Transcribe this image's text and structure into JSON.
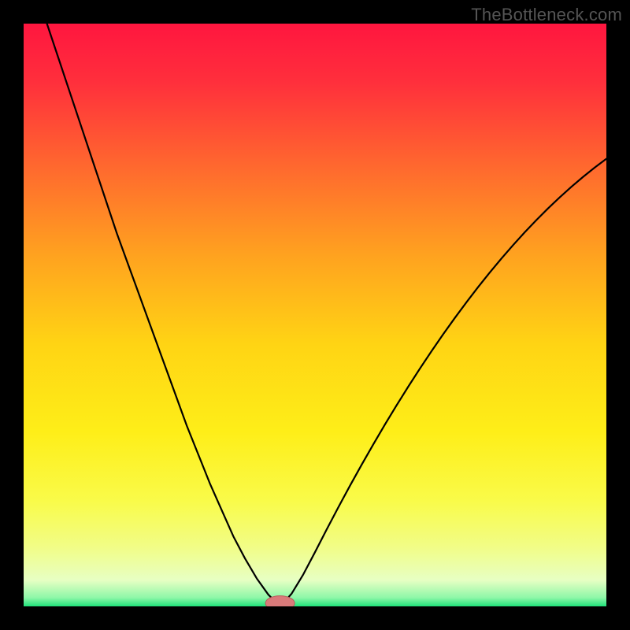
{
  "watermark": "TheBottleneck.com",
  "colors": {
    "frame": "#000000",
    "gradient_stops": [
      {
        "offset": 0.0,
        "color": "#ff163f"
      },
      {
        "offset": 0.1,
        "color": "#ff2f3c"
      },
      {
        "offset": 0.25,
        "color": "#ff6a2e"
      },
      {
        "offset": 0.4,
        "color": "#ffa31f"
      },
      {
        "offset": 0.55,
        "color": "#ffd414"
      },
      {
        "offset": 0.7,
        "color": "#feee18"
      },
      {
        "offset": 0.82,
        "color": "#f9fb4a"
      },
      {
        "offset": 0.9,
        "color": "#f1fd88"
      },
      {
        "offset": 0.955,
        "color": "#e7ffc3"
      },
      {
        "offset": 0.985,
        "color": "#8ff7a8"
      },
      {
        "offset": 1.0,
        "color": "#1ee27a"
      }
    ],
    "curve": "#000000",
    "marker_fill": "#d97a7a",
    "marker_stroke": "#b85a5a"
  },
  "chart_data": {
    "type": "line",
    "title": "",
    "xlabel": "",
    "ylabel": "",
    "xlim": [
      0,
      100
    ],
    "ylim": [
      0,
      100
    ],
    "grid": false,
    "legend": false,
    "optimum_x": 44,
    "marker": {
      "x": 44,
      "y": 0,
      "rx": 2.5,
      "ry": 1.0
    },
    "series": [
      {
        "name": "left-branch",
        "x": [
          4,
          6,
          8,
          10,
          12,
          14,
          16,
          18,
          20,
          22,
          24,
          26,
          28,
          30,
          32,
          34,
          36,
          38,
          40,
          42,
          43.5
        ],
        "y": [
          100,
          94,
          88,
          82,
          76,
          70,
          64,
          58.5,
          53,
          47.5,
          42,
          36.5,
          31,
          26,
          21,
          16.5,
          12,
          8.2,
          4.8,
          2.0,
          0.5
        ]
      },
      {
        "name": "right-branch",
        "x": [
          44.5,
          46,
          48,
          50,
          52,
          54,
          56,
          58,
          60,
          62,
          64,
          66,
          68,
          70,
          72,
          74,
          76,
          78,
          80,
          82,
          84,
          86,
          88,
          90,
          92,
          94,
          96,
          98,
          100
        ],
        "y": [
          0.5,
          2.2,
          5.5,
          9.3,
          13.2,
          17.0,
          20.7,
          24.3,
          27.8,
          31.2,
          34.5,
          37.7,
          40.8,
          43.8,
          46.7,
          49.5,
          52.2,
          54.8,
          57.3,
          59.7,
          62.0,
          64.2,
          66.3,
          68.3,
          70.2,
          72.0,
          73.7,
          75.3,
          76.8
        ]
      }
    ]
  }
}
